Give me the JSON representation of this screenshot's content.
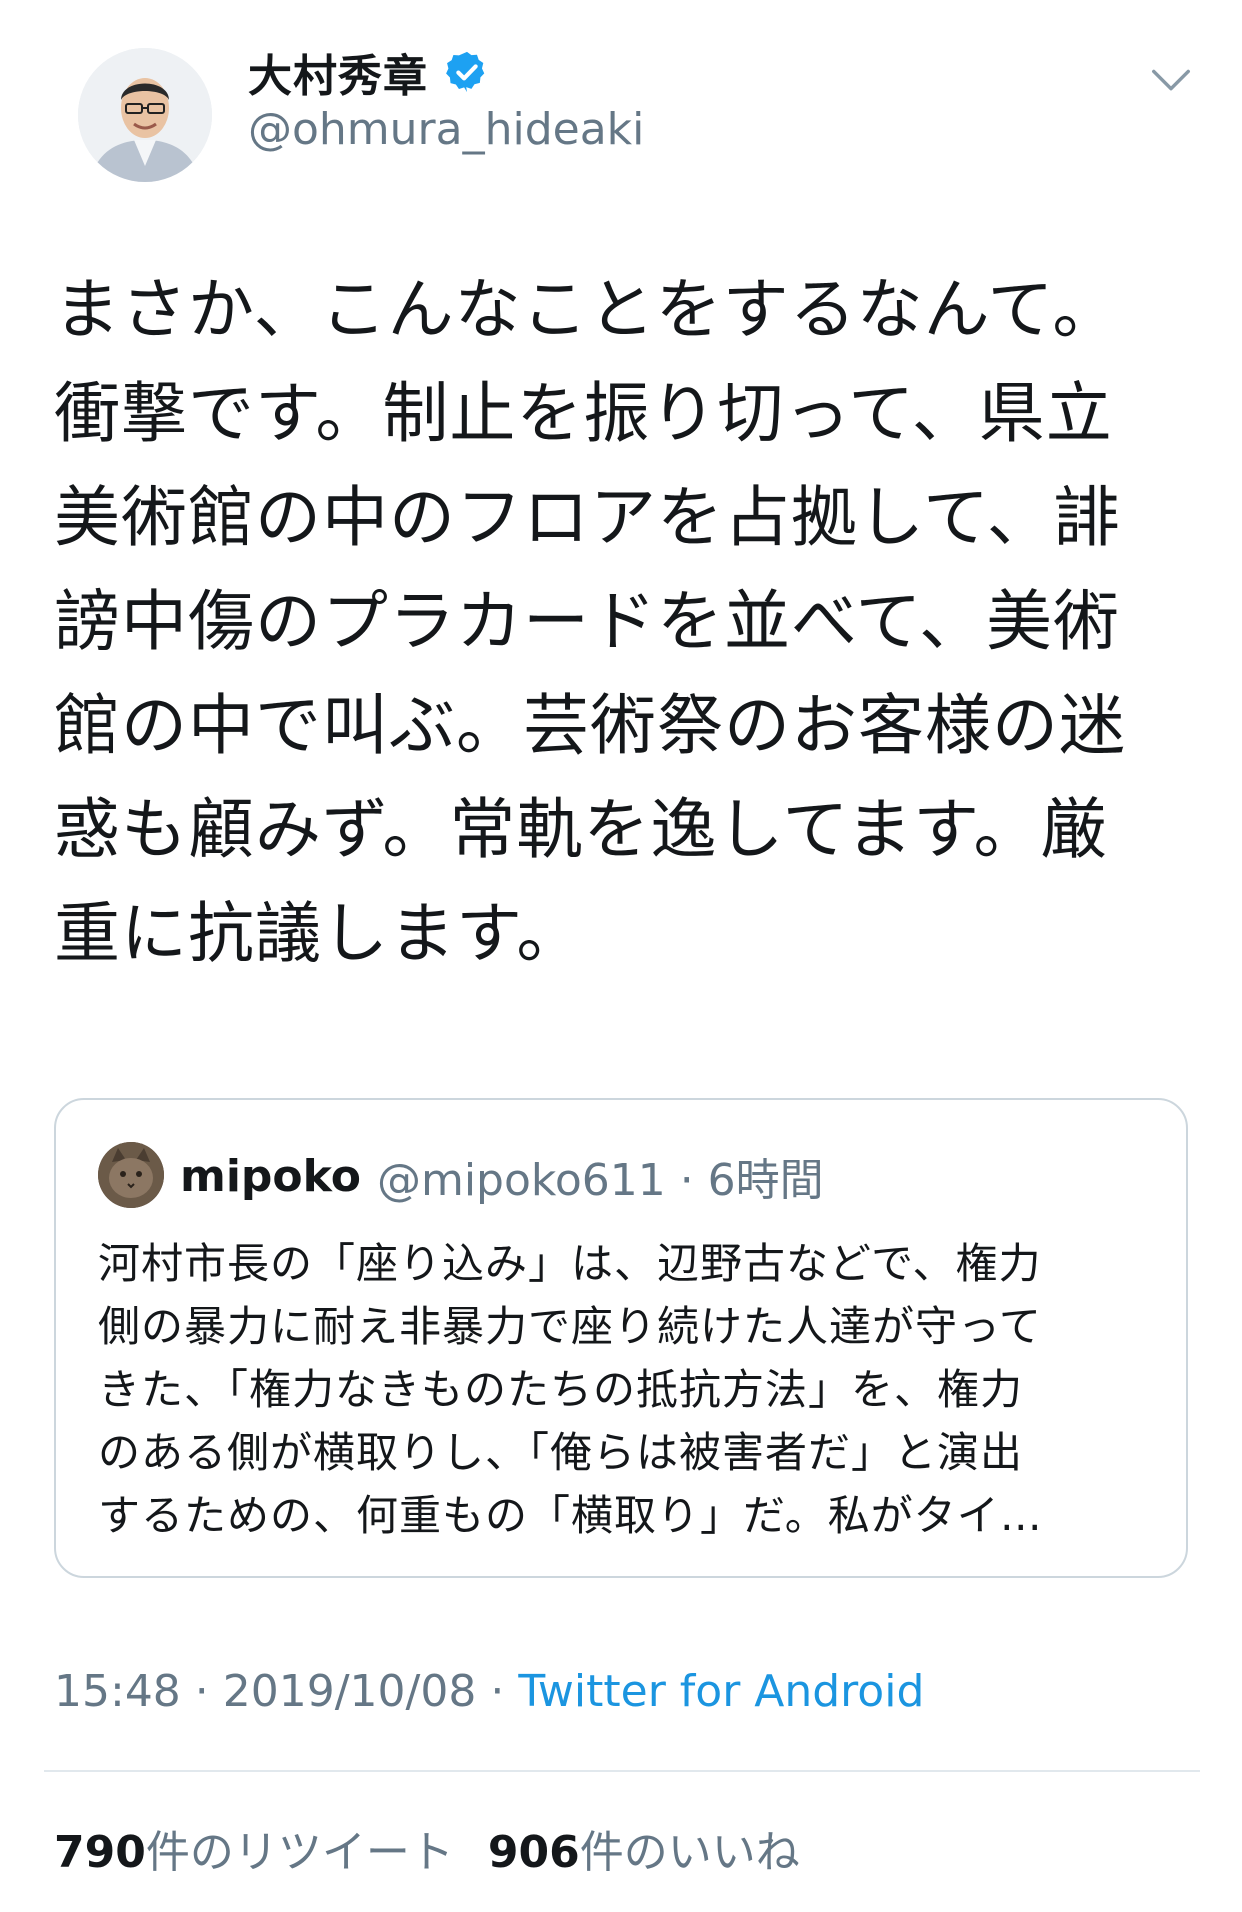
{
  "author": {
    "display_name": "大村秀章",
    "handle": "@ohmura_hideaki",
    "verified": true,
    "avatar_icon": "profile-photo-icon"
  },
  "tweet": {
    "lines": [
      "まさか、こんなことをするなんて。",
      "衝撃です。制止を振り切って、県立",
      "美術館の中のフロアを占拠して、誹",
      "謗中傷のプラカードを並べて、美術",
      "館の中で叫ぶ。芸術祭のお客様の迷",
      "惑も顧みず。常軌を逸してます。厳",
      "重に抗議します。"
    ]
  },
  "quoted_tweet": {
    "display_name": "mipoko",
    "handle_time": "@mipoko611 · 6時間",
    "lines": [
      "河村市長の「座り込み」は、辺野古などで、権力",
      "側の暴力に耐え非暴力で座り続けた人達が守って",
      "きた、「権力なきものたちの抵抗方法」を、権力",
      "のある側が横取りし、「俺らは被害者だ」と演出",
      "するための、何重もの「横取り」だ。私がタイ…"
    ]
  },
  "meta": {
    "time_date": "15:48 · 2019/10/08 · ",
    "source": "Twitter for Android"
  },
  "stats": {
    "retweets_count": "790",
    "retweets_label": "件のリツイート",
    "likes_count": "906",
    "likes_label": "件のいいね"
  },
  "colors": {
    "text": "#14171a",
    "secondary": "#657786",
    "link": "#1b95e0",
    "verified": "#1da1f2",
    "border": "#ccd6dd"
  }
}
